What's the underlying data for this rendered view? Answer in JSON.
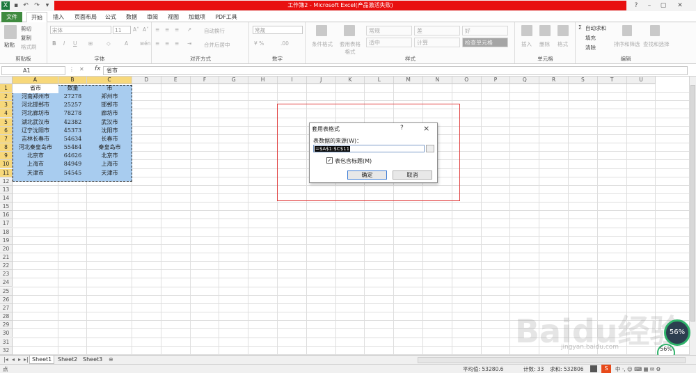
{
  "window": {
    "title": "工作簿2 - Microsoft Excel(产品激活失败)"
  },
  "tabs": [
    "文件",
    "开始",
    "插入",
    "页面布局",
    "公式",
    "数据",
    "审阅",
    "视图",
    "加载项",
    "PDF工具"
  ],
  "ribbon": {
    "clipboard": {
      "paste": "粘贴",
      "cut": "剪切",
      "copy": "复制",
      "format_painter": "格式刷",
      "label": "剪贴板"
    },
    "font": {
      "name": "宋体",
      "size": "11",
      "label": "字体"
    },
    "alignment": {
      "wrap": "自动换行",
      "merge": "合并后居中",
      "label": "对齐方式"
    },
    "number": {
      "format": "常规",
      "label": "数字"
    },
    "styles": {
      "conditional": "条件格式",
      "table_format": "套用表格格式",
      "cells": [
        "常规",
        "差",
        "好",
        "适中",
        "计算",
        "检查单元格"
      ],
      "label": "样式"
    },
    "cells_group": {
      "insert": "插入",
      "delete": "删除",
      "format": "格式",
      "label": "单元格"
    },
    "editing": {
      "autosum": "自动求和",
      "fill": "填充",
      "clear": "清除",
      "sort": "排序和筛选",
      "find": "查找和选择",
      "label": "编辑"
    }
  },
  "formula_bar": {
    "name_box": "A1",
    "fx": "fx",
    "value": "省市"
  },
  "columns": [
    "A",
    "B",
    "C",
    "D",
    "E",
    "F",
    "G",
    "H",
    "I",
    "J",
    "K",
    "L",
    "M",
    "N",
    "O",
    "P",
    "Q",
    "R",
    "S",
    "T",
    "U"
  ],
  "rows": [
    "1",
    "2",
    "3",
    "4",
    "5",
    "6",
    "7",
    "8",
    "9",
    "10",
    "11",
    "12",
    "13",
    "14",
    "15",
    "16",
    "17",
    "18",
    "19",
    "20",
    "21",
    "22",
    "23",
    "24",
    "25",
    "26",
    "27",
    "28",
    "29",
    "30",
    "31",
    "32"
  ],
  "table": [
    [
      "省市",
      "数量",
      "市"
    ],
    [
      "河南郑州市",
      "27278",
      "郑州市"
    ],
    [
      "河北邯郸市",
      "25257",
      "邯郸市"
    ],
    [
      "河北廊坊市",
      "78278",
      "廊坊市"
    ],
    [
      "湖北武汉市",
      "42382",
      "武汉市"
    ],
    [
      "辽宁沈阳市",
      "45373",
      "沈阳市"
    ],
    [
      "吉林长春市",
      "54634",
      "长春市"
    ],
    [
      "河北秦皇岛市",
      "55484",
      "秦皇岛市"
    ],
    [
      "北京市",
      "64626",
      "北京市"
    ],
    [
      "上海市",
      "84949",
      "上海市"
    ],
    [
      "天津市",
      "54545",
      "天津市"
    ]
  ],
  "dialog": {
    "title": "套用表格式",
    "help": "?",
    "close": "×",
    "source_label": "表数据的来源(W)：",
    "source_value": "=$A$1:$C$11",
    "has_headers": "表包含标题(M)",
    "ok": "确定",
    "cancel": "取消"
  },
  "sheets": [
    "Sheet1",
    "Sheet2",
    "Sheet3"
  ],
  "status": {
    "ready": "点",
    "average": "平均值: 53280.6",
    "count": "计数: 33",
    "sum": "求和: 532806"
  },
  "overlay": {
    "watermark": "Baidu经验",
    "watermark_url": "jingyan.baidu.com",
    "gauge": "56%",
    "gauge_small": "56%"
  }
}
